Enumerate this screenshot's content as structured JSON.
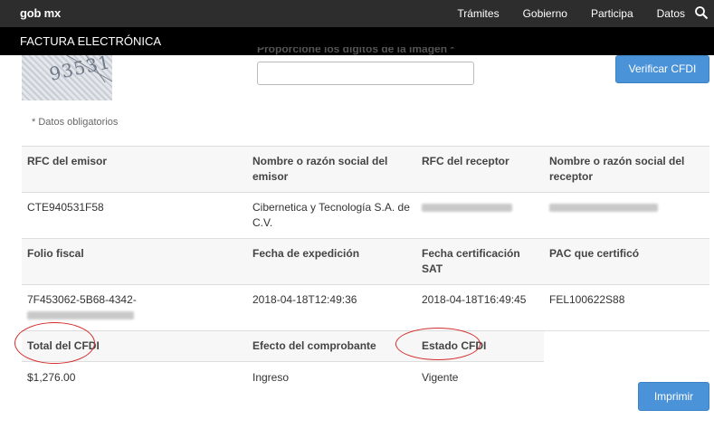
{
  "nav": {
    "brand": "gob mx",
    "links": [
      "Trámites",
      "Gobierno",
      "Participa",
      "Datos"
    ],
    "search_icon": "search-icon"
  },
  "page": {
    "section_title": "FACTURA ELECTRÓNICA"
  },
  "captcha": {
    "image_digits": "93531",
    "label": "Proporcione los dígitos de la imagen *",
    "input_value": ""
  },
  "buttons": {
    "verificar": "Verificar CFDI",
    "imprimir": "Imprimir"
  },
  "required_note": "* Datos obligatorios",
  "invoice": {
    "headers_1": [
      "RFC del emisor",
      "Nombre o razón social del emisor",
      "RFC del receptor",
      "Nombre o razón social del receptor"
    ],
    "values_1": {
      "rfc_emisor": "CTE940531F58",
      "nombre_emisor": "Cibernetica y Tecnología S.A. de C.V."
    },
    "headers_2": [
      "Folio fiscal",
      "Fecha de expedición",
      "Fecha certificación SAT",
      "PAC que certificó"
    ],
    "values_2": {
      "folio_fiscal": "7F453062-5B68-4342-",
      "fecha_expedicion": "2018-04-18T12:49:36",
      "fecha_certificacion": "2018-04-18T16:49:45",
      "pac": "FEL100622S88"
    },
    "headers_3": [
      "Total del CFDI",
      "Efecto del comprobante",
      "Estado CFDI"
    ],
    "values_3": {
      "total": "$1,276.00",
      "efecto": "Ingreso",
      "estado": "Vigente"
    }
  },
  "colors": {
    "topbar": "#2d2d2d",
    "subbar": "#000000",
    "button": "#4b93d8",
    "annotation_circle": "#d42a2a"
  }
}
